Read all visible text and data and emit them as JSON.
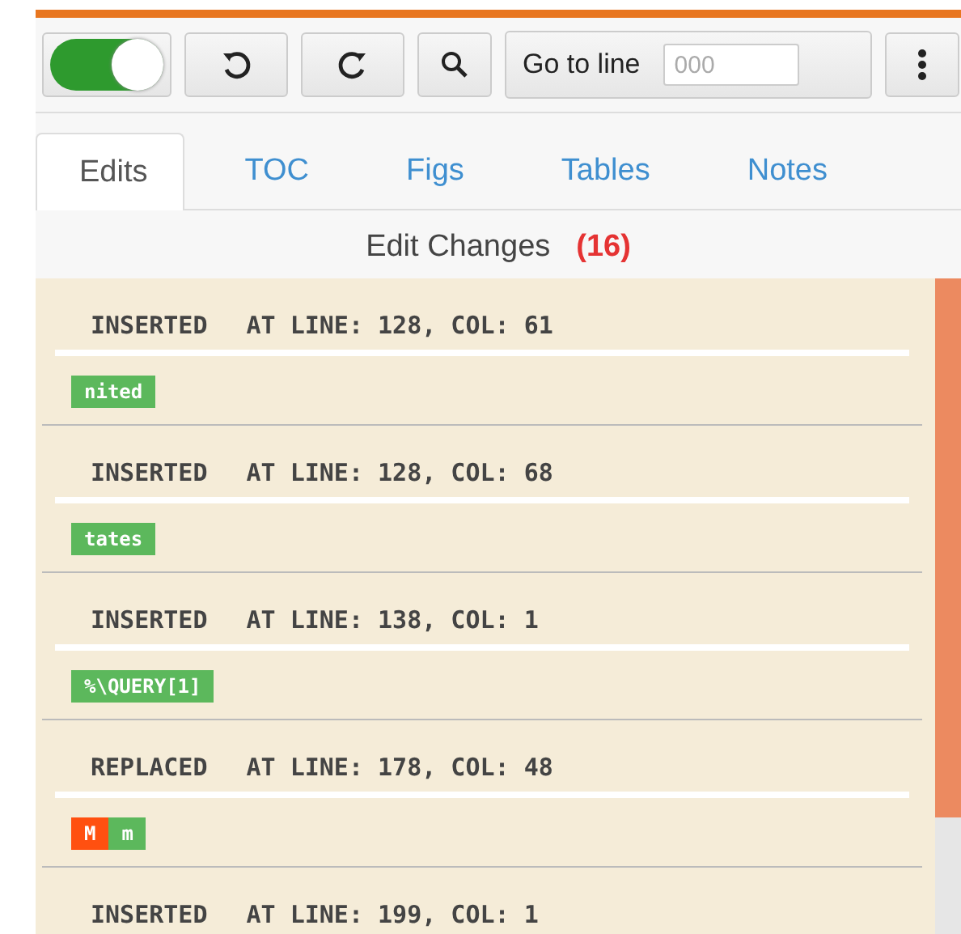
{
  "toolbar": {
    "toggle": {
      "on": true
    },
    "goto_label": "Go to line",
    "goto_placeholder": "000"
  },
  "tabs": [
    {
      "label": "Edits",
      "selected": true
    },
    {
      "label": "TOC",
      "selected": false
    },
    {
      "label": "Figs",
      "selected": false
    },
    {
      "label": "Tables",
      "selected": false
    },
    {
      "label": "Notes",
      "selected": false
    }
  ],
  "heading": {
    "title": "Edit Changes",
    "count": "(16)"
  },
  "edits": [
    {
      "action": "INSERTED",
      "location": "AT LINE: 128, COL: 61",
      "chips": [
        {
          "kind": "added",
          "text": "nited"
        }
      ]
    },
    {
      "action": "INSERTED",
      "location": "AT LINE: 128, COL: 68",
      "chips": [
        {
          "kind": "added",
          "text": "tates"
        }
      ]
    },
    {
      "action": "INSERTED",
      "location": "AT LINE: 138, COL: 1",
      "chips": [
        {
          "kind": "added",
          "text": "%\\QUERY[1]"
        }
      ]
    },
    {
      "action": "REPLACED",
      "location": "AT LINE: 178, COL: 48",
      "chips": [
        {
          "kind": "removed",
          "text": "M"
        },
        {
          "kind": "added",
          "text": "m"
        }
      ]
    },
    {
      "action": "INSERTED",
      "location": "AT LINE: 199, COL: 1"
    }
  ]
}
